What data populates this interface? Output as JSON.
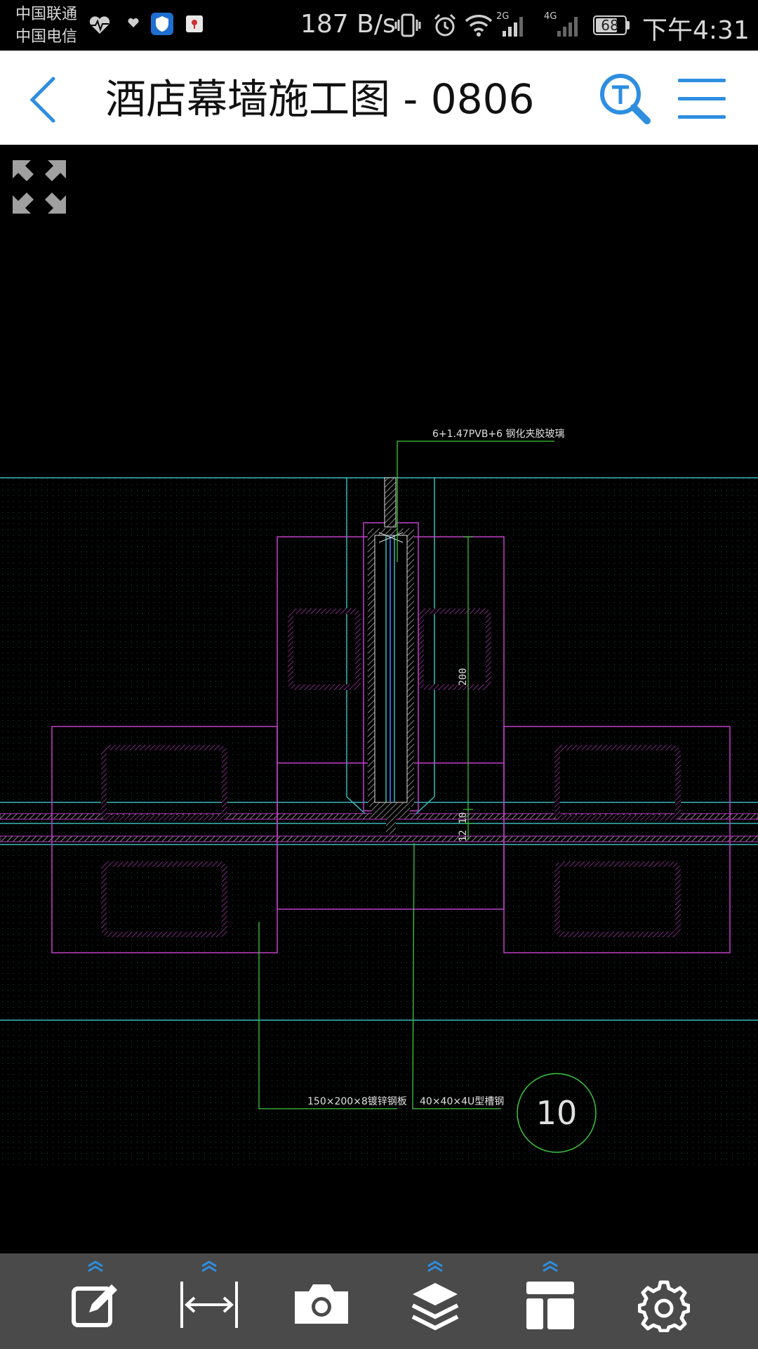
{
  "status_bar": {
    "carrier_1": "中国联通",
    "carrier_2": "中国电信",
    "net_speed": "187 B/s",
    "signal_1_type": "2G",
    "signal_2_type": "4G",
    "battery": "68",
    "time": "下午4:31"
  },
  "header": {
    "title": "酒店幕墙施工图 - 0806",
    "back_icon": "chevron-left-icon",
    "search_icon": "text-search-icon",
    "menu_icon": "hamburger-menu-icon",
    "accent_color": "#2e8ee0"
  },
  "viewer": {
    "expand_icon": "fullscreen-expand-icon",
    "background": "#000000"
  },
  "drawing": {
    "annotations": {
      "glass_label": "6+1.47PVB+6 钢化夹胶玻璃",
      "plate_label": "150×200×8镀锌钢板",
      "channel_label": "40×40×4U型槽钢",
      "dim_200": "200",
      "dim_12_10": "12 10",
      "detail_number": "10"
    },
    "colors": {
      "cyan": "#3cb8b8",
      "magenta": "#c040c8",
      "green": "#3cc83c",
      "blue": "#3060d0",
      "white": "#e0e0e0"
    }
  },
  "toolbar": {
    "items": [
      {
        "name": "markup-tool",
        "icon": "edit-note-icon"
      },
      {
        "name": "measure-tool",
        "icon": "measure-distance-icon"
      },
      {
        "name": "camera-tool",
        "icon": "camera-icon"
      },
      {
        "name": "layers-tool",
        "icon": "layers-icon"
      },
      {
        "name": "layout-tool",
        "icon": "layout-icon"
      },
      {
        "name": "settings-tool",
        "icon": "gear-icon"
      }
    ],
    "background": "#4a4a4a",
    "chevron_color": "#2e8ee0"
  }
}
